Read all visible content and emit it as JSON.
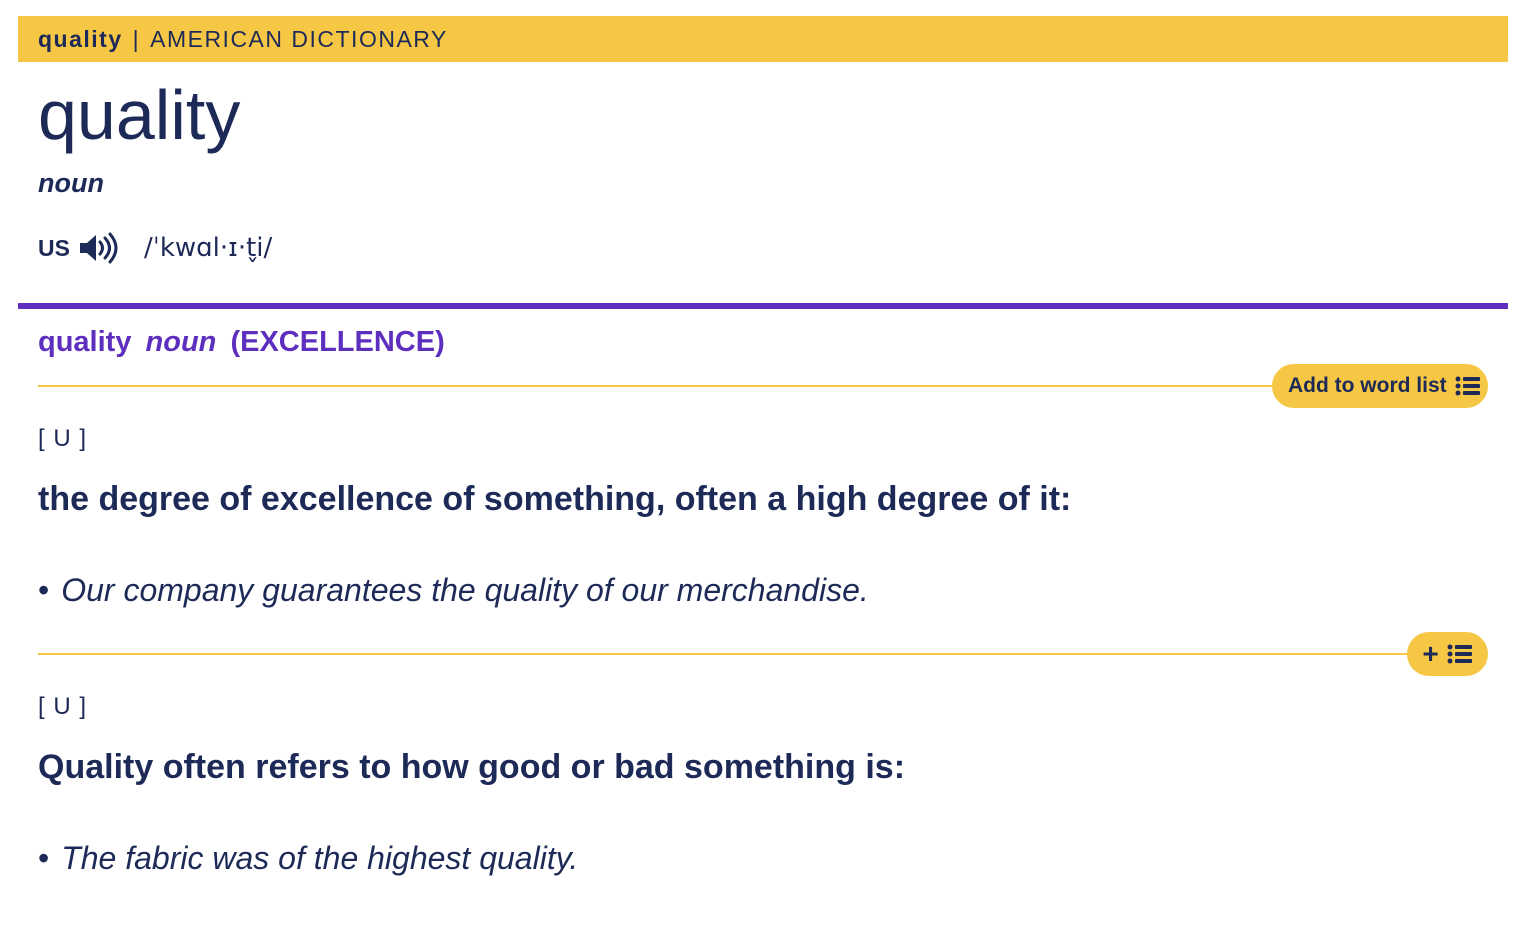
{
  "banner": {
    "headword": "quality",
    "separator": "|",
    "dictionary": "AMERICAN DICTIONARY"
  },
  "entry": {
    "headword": "quality",
    "part_of_speech": "noun",
    "pronunciation": {
      "region": "US",
      "audio_icon": "speaker-icon",
      "ipa": "/ˈkwɑl·ɪ·t̬i/"
    }
  },
  "sense": {
    "headword": "quality",
    "part_of_speech": "noun",
    "guideword": "(EXCELLENCE)",
    "add_to_word_list_label": "Add to word list",
    "list_icon": "list-icon",
    "plus_symbol": "+",
    "definitions": [
      {
        "grammar": "[ U ]",
        "text": "the degree of excellence of something, often a high degree of it:",
        "example_bullet": "•",
        "example": "Our company guarantees the quality of our merchandise."
      },
      {
        "grammar": "[ U ]",
        "text": "Quality often refers to how good or bad something is:",
        "example_bullet": "•",
        "example": "The fabric was of the highest quality."
      }
    ]
  },
  "colors": {
    "banner_yellow": "#f6c744",
    "navy_text": "#1d2a57",
    "sense_purple": "#5e2fbf"
  }
}
